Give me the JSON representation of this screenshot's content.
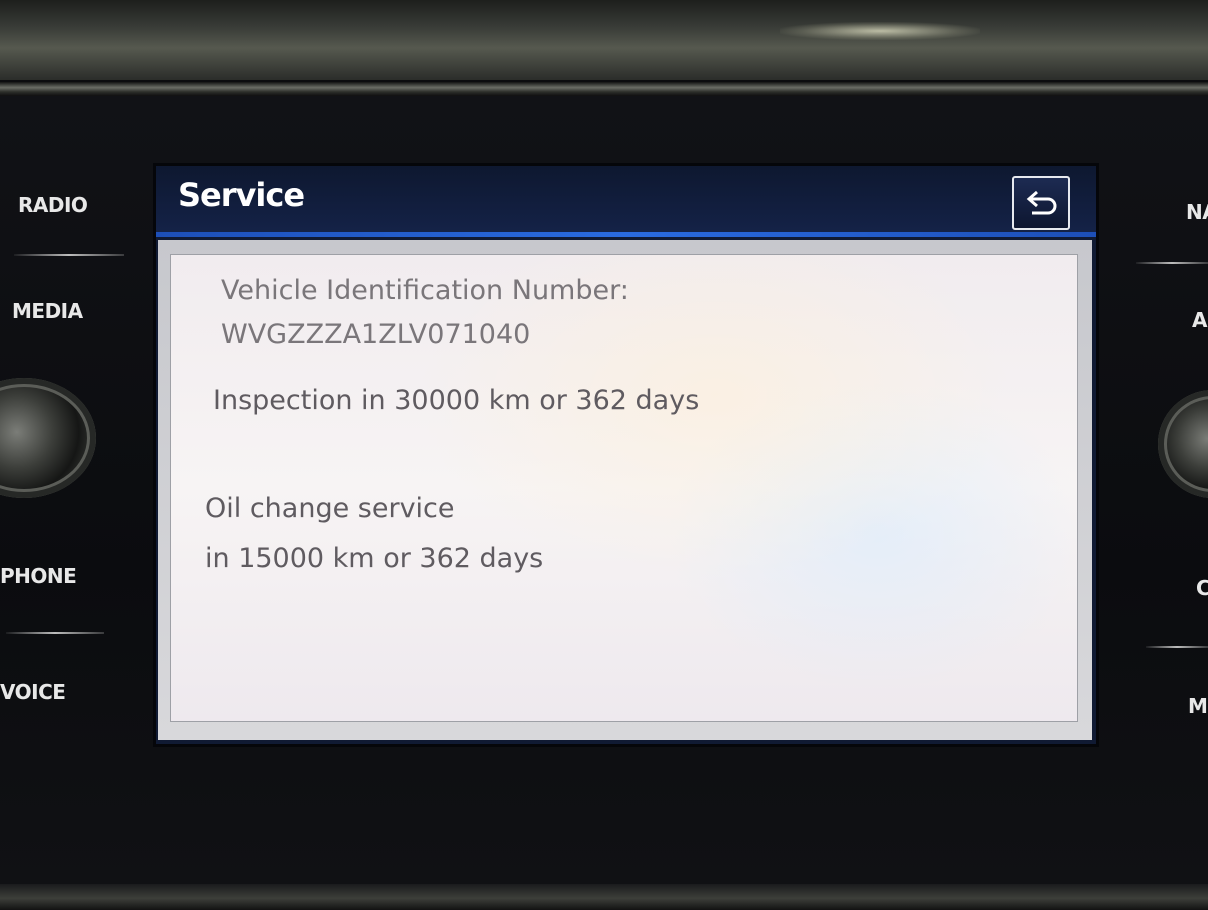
{
  "hardware_buttons": {
    "left": {
      "radio": "RADIO",
      "media": "MEDIA",
      "phone": "PHONE",
      "voice": "VOICE"
    },
    "right": {
      "nav": "NA",
      "app": "A",
      "car": "C",
      "menu": "M"
    }
  },
  "screen": {
    "title": "Service",
    "back_icon": "back-arrow-icon",
    "vin_label": "Vehicle Identification Number:",
    "vin_value": "WVGZZZA1ZLV071040",
    "inspection": "Inspection in 30000 km or 362 days",
    "oil_line1": "Oil change service",
    "oil_line2": "in 15000 km or 362 days"
  },
  "colors": {
    "header_bg": "#142247",
    "accent_rule": "#2a6be0",
    "content_bg": "#f5f2f3",
    "text": "#6e6a6e"
  }
}
